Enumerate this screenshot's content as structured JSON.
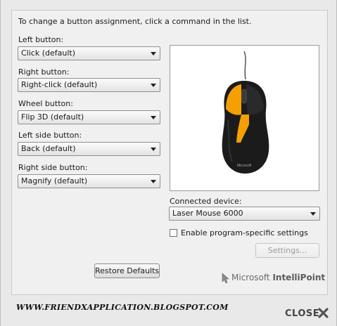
{
  "instruction": "To change a button assignment, click a command in the list.",
  "assignments": [
    {
      "label": "Left button:",
      "value": "Click (default)"
    },
    {
      "label": "Right button:",
      "value": "Right-click (default)"
    },
    {
      "label": "Wheel button:",
      "value": "Flip 3D (default)"
    },
    {
      "label": "Left side button:",
      "value": "Back (default)"
    },
    {
      "label": "Right side button:",
      "value": "Magnify (default)"
    }
  ],
  "device": {
    "label": "Connected device:",
    "value": "Laser Mouse 6000"
  },
  "program_specific": {
    "label": "Enable program-specific settings",
    "checked": false
  },
  "settings_button": "Settings...",
  "restore_button": "Restore Defaults",
  "brand": {
    "prefix": "Microsoft",
    "name": "IntelliPoint"
  },
  "watermark": "WWW.FRIENDXAPPLICATION.BLOGSPOT.COM",
  "close_label": "CLOSE",
  "colors": {
    "highlight": "#f5a000",
    "mouse_body": "#1b1b1b"
  }
}
